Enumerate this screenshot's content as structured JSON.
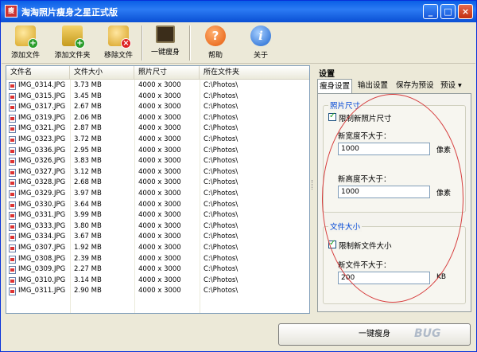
{
  "window": {
    "title": "淘淘照片瘦身之星正式版",
    "icon_text": "瘦"
  },
  "window_controls": {
    "minimize": "_",
    "maximize": "□",
    "close": "×"
  },
  "toolbar": {
    "items": [
      {
        "label": "添加文件",
        "icon": "add-file-icon"
      },
      {
        "label": "添加文件夹",
        "icon": "add-folder-icon"
      },
      {
        "label": "移除文件",
        "icon": "remove-file-icon"
      },
      {
        "label": "一键瘦身",
        "icon": "slim-icon"
      },
      {
        "label": "帮助",
        "icon": "help-icon"
      },
      {
        "label": "关于",
        "icon": "about-icon"
      }
    ],
    "help_glyph": "?",
    "about_glyph": "i"
  },
  "file_list": {
    "columns": [
      "文件名",
      "文件大小",
      "照片尺寸",
      "所在文件夹"
    ],
    "rows": [
      {
        "name": "IMG_0314.JPG",
        "size": "3.73 MB",
        "dim": "4000 x 3000",
        "folder": "C:\\Photos\\"
      },
      {
        "name": "IMG_0315.JPG",
        "size": "3.45 MB",
        "dim": "4000 x 3000",
        "folder": "C:\\Photos\\"
      },
      {
        "name": "IMG_0317.JPG",
        "size": "2.67 MB",
        "dim": "4000 x 3000",
        "folder": "C:\\Photos\\"
      },
      {
        "name": "IMG_0319.JPG",
        "size": "2.06 MB",
        "dim": "4000 x 3000",
        "folder": "C:\\Photos\\"
      },
      {
        "name": "IMG_0321.JPG",
        "size": "2.87 MB",
        "dim": "4000 x 3000",
        "folder": "C:\\Photos\\"
      },
      {
        "name": "IMG_0323.JPG",
        "size": "3.72 MB",
        "dim": "4000 x 3000",
        "folder": "C:\\Photos\\"
      },
      {
        "name": "IMG_0336.JPG",
        "size": "2.95 MB",
        "dim": "4000 x 3000",
        "folder": "C:\\Photos\\"
      },
      {
        "name": "IMG_0326.JPG",
        "size": "3.83 MB",
        "dim": "4000 x 3000",
        "folder": "C:\\Photos\\"
      },
      {
        "name": "IMG_0327.JPG",
        "size": "3.12 MB",
        "dim": "4000 x 3000",
        "folder": "C:\\Photos\\"
      },
      {
        "name": "IMG_0328.JPG",
        "size": "2.68 MB",
        "dim": "4000 x 3000",
        "folder": "C:\\Photos\\"
      },
      {
        "name": "IMG_0329.JPG",
        "size": "3.97 MB",
        "dim": "4000 x 3000",
        "folder": "C:\\Photos\\"
      },
      {
        "name": "IMG_0330.JPG",
        "size": "3.64 MB",
        "dim": "4000 x 3000",
        "folder": "C:\\Photos\\"
      },
      {
        "name": "IMG_0331.JPG",
        "size": "3.99 MB",
        "dim": "4000 x 3000",
        "folder": "C:\\Photos\\"
      },
      {
        "name": "IMG_0333.JPG",
        "size": "3.80 MB",
        "dim": "4000 x 3000",
        "folder": "C:\\Photos\\"
      },
      {
        "name": "IMG_0334.JPG",
        "size": "3.67 MB",
        "dim": "4000 x 3000",
        "folder": "C:\\Photos\\"
      },
      {
        "name": "IMG_0307.JPG",
        "size": "1.92 MB",
        "dim": "4000 x 3000",
        "folder": "C:\\Photos\\"
      },
      {
        "name": "IMG_0308.JPG",
        "size": "2.39 MB",
        "dim": "4000 x 3000",
        "folder": "C:\\Photos\\"
      },
      {
        "name": "IMG_0309.JPG",
        "size": "2.27 MB",
        "dim": "4000 x 3000",
        "folder": "C:\\Photos\\"
      },
      {
        "name": "IMG_0310.JPG",
        "size": "3.14 MB",
        "dim": "4000 x 3000",
        "folder": "C:\\Photos\\"
      },
      {
        "name": "IMG_0311.JPG",
        "size": "2.90 MB",
        "dim": "4000 x 3000",
        "folder": "C:\\Photos\\"
      }
    ]
  },
  "settings": {
    "title": "设置",
    "tabs": [
      "瘦身设置",
      "输出设置",
      "保存为预设",
      "预设 ▾"
    ],
    "photo_size_group": {
      "title": "照片尺寸",
      "limit_label": "限制新照片尺寸",
      "limit_checked": true,
      "width_label": "新宽度不大于：",
      "width_value": "1000",
      "height_label": "新高度不大于：",
      "height_value": "1000",
      "unit": "像素"
    },
    "file_size_group": {
      "title": "文件大小",
      "limit_label": "限制新文件大小",
      "limit_checked": true,
      "size_label": "新文件不大于：",
      "size_value": "200",
      "unit": "KB"
    }
  },
  "action_button": {
    "label": "一键瘦身"
  },
  "watermark": "BUG"
}
